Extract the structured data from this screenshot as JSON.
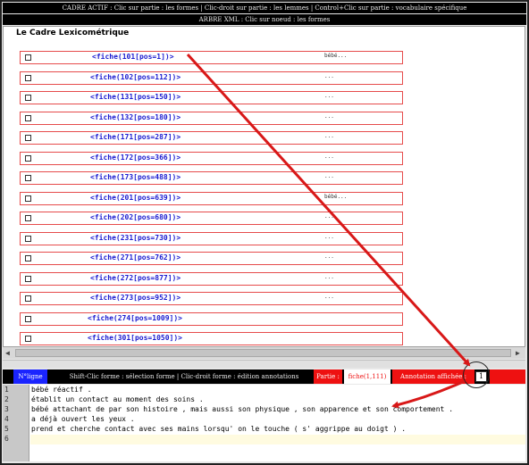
{
  "header": {
    "line1": "CADRE ACTIF : Clic sur partie : les formes | Clic-droit sur partie : les lemmes | Control+Clic sur partie : vocabulaire spécifique",
    "line2": "ARBRE XML : Clic sur noeud : les formes"
  },
  "panel": {
    "title": "Le Cadre Lexicométrique",
    "rows": [
      {
        "label": "<fiche(101[pos=1])>",
        "value": "bébé..."
      },
      {
        "label": "<fiche(102[pos=112])>",
        "value": "..."
      },
      {
        "label": "<fiche(131[pos=150])>",
        "value": "..."
      },
      {
        "label": "<fiche(132[pos=180])>",
        "value": "..."
      },
      {
        "label": "<fiche(171[pos=287])>",
        "value": "..."
      },
      {
        "label": "<fiche(172[pos=366])>",
        "value": "..."
      },
      {
        "label": "<fiche(173[pos=488])>",
        "value": "..."
      },
      {
        "label": "<fiche(201[pos=639])>",
        "value": "bébé..."
      },
      {
        "label": "<fiche(202[pos=680])>",
        "value": "..."
      },
      {
        "label": "<fiche(231[pos=730])>",
        "value": "..."
      },
      {
        "label": "<fiche(271[pos=762])>",
        "value": "..."
      },
      {
        "label": "<fiche(272[pos=877])>",
        "value": "..."
      },
      {
        "label": "<fiche(273[pos=952])>",
        "value": "..."
      },
      {
        "label": "<fiche(274[pos=1009])>",
        "value": ""
      },
      {
        "label": "<fiche(301[pos=1050])>",
        "value": ""
      }
    ]
  },
  "status": {
    "n_ligne": "N°ligne",
    "help": "Shift-Clic forme : sélection forme | Clic-droit forme : édition annotations",
    "partie_label": "Partie :",
    "partie_value": "fiche(1,111)",
    "annotation_label": "Annotation affichée :",
    "annotation_value": "1"
  },
  "editor": {
    "line_numbers": [
      "1",
      "2",
      "3",
      "4",
      "5",
      "6"
    ],
    "lines": [
      "bébé réactif .",
      "établit un contact au moment des soins .",
      "bébé attachant de par son histoire , mais aussi son physique , son apparence et son comportement .",
      "a déjà ouvert les yeux .",
      "prend et cherche contact avec ses mains lorsqu' on le touche ( s' aggrippe au doigt ) .",
      ""
    ]
  },
  "colors": {
    "row_border": "#e64b4b",
    "fiche_text": "#1a1ad0",
    "status_red": "#ee1111",
    "status_blue": "#1a24ff",
    "arrow_red": "#d81818"
  },
  "icons": {
    "row_checkbox": "checkbox-icon",
    "scroll_left": "arrow-left-icon",
    "scroll_right": "arrow-right-icon"
  }
}
